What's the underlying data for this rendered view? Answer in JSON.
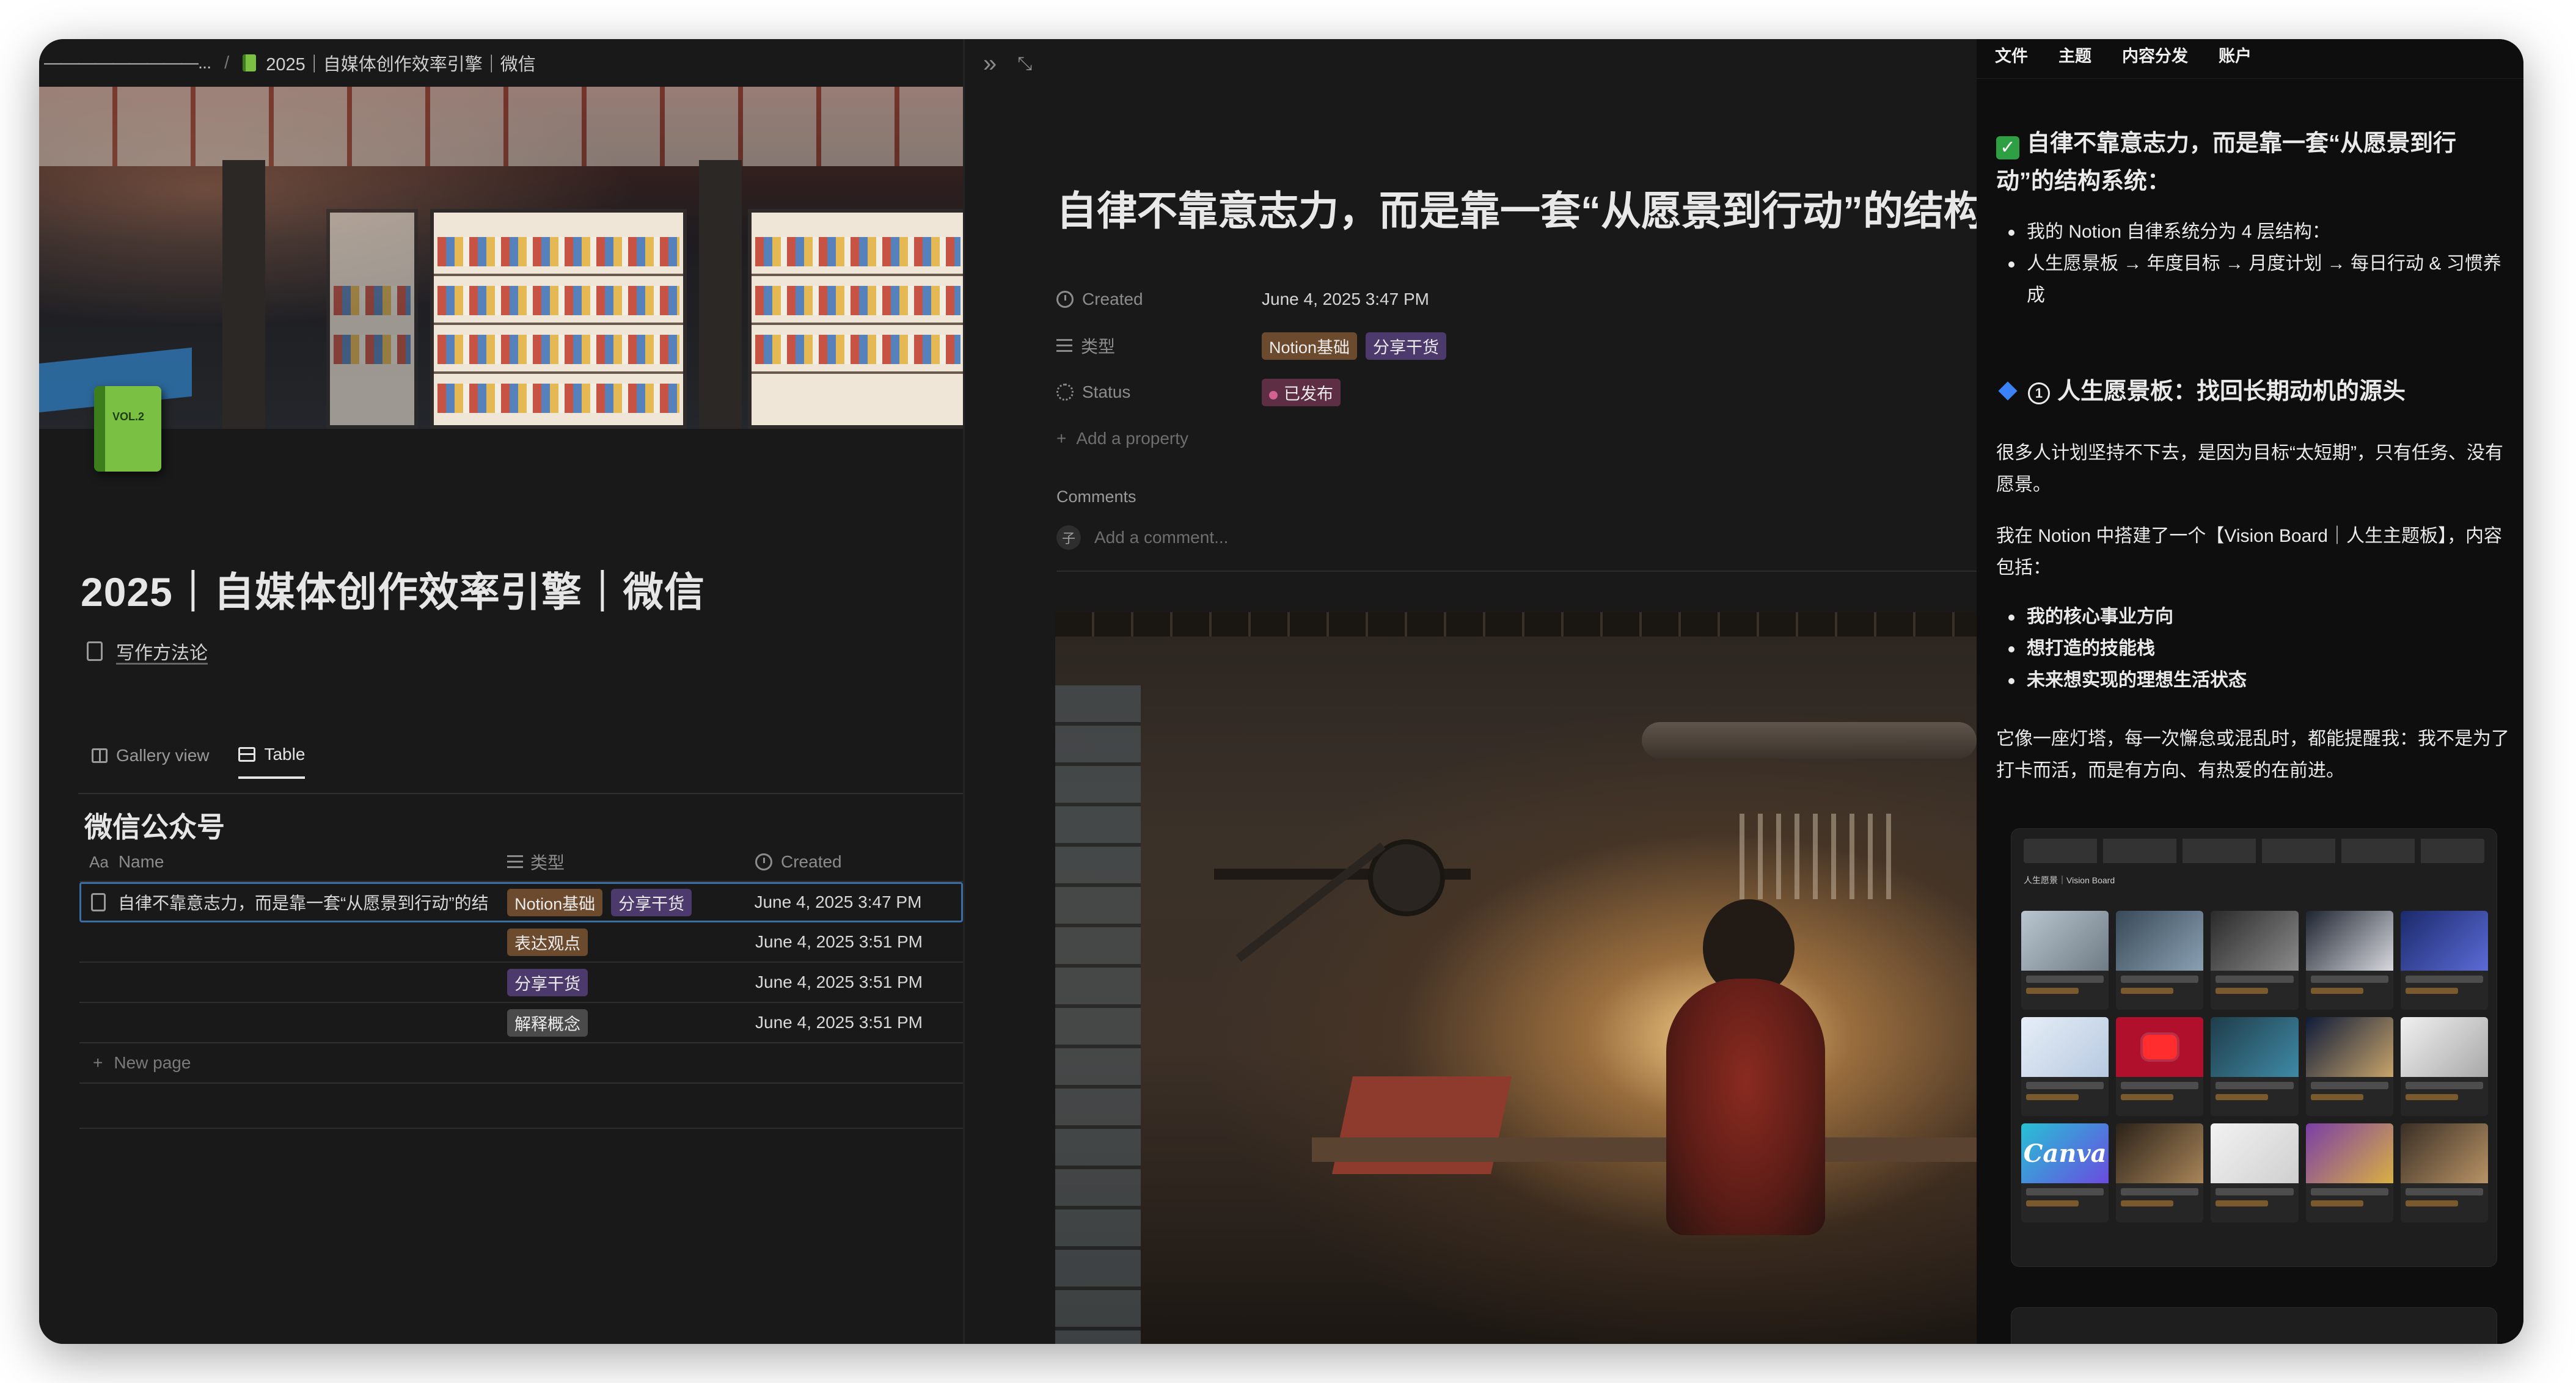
{
  "left": {
    "breadcrumb": {
      "parent": "—————————...",
      "current": "2025｜自媒体创作效率引擎｜微信"
    },
    "page_title": "2025｜自媒体创作效率引擎｜微信",
    "linked_page": "写作方法论",
    "views": [
      "Gallery view",
      "Table"
    ],
    "active_view": "Table",
    "database_title": "微信公众号",
    "columns": {
      "name": "Name",
      "type": "类型",
      "created": "Created",
      "name_prefix": "Aa"
    },
    "rows": [
      {
        "name": "自律不靠意志力，而是靠一套“从愿景到行动”的结",
        "tags": [
          "Notion基础",
          "分享干货"
        ],
        "created": "June 4, 2025 3:47 PM"
      },
      {
        "name": "",
        "tags": [
          "表达观点"
        ],
        "created": "June 4, 2025 3:51 PM"
      },
      {
        "name": "",
        "tags": [
          "分享干货"
        ],
        "created": "June 4, 2025 3:51 PM"
      },
      {
        "name": "",
        "tags": [
          "解释概念"
        ],
        "created": "June 4, 2025 3:51 PM"
      }
    ],
    "new_page": "New page"
  },
  "middle": {
    "title": "自律不靠意志力，而是靠一套“从愿景到行动”的结构系统",
    "props": {
      "created_label": "Created",
      "created_value": "June 4, 2025 3:47 PM",
      "type_label": "类型",
      "type_tags": [
        "Notion基础",
        "分享干货"
      ],
      "status_label": "Status",
      "status_value": "已发布",
      "add_property": "Add a property"
    },
    "comments_label": "Comments",
    "comment_placeholder": "Add a comment...",
    "avatar_initial": "子"
  },
  "right": {
    "menu": [
      "文件",
      "主题",
      "内容分发",
      "账户"
    ],
    "heading1": "自律不靠意志力，而是靠一套“从愿景到行动”的结构系统：",
    "bullets1": [
      "我的 Notion 自律系统分为 4 层结构：",
      "人生愿景板 → 年度目标 → 月度计划 → 每日行动 & 习惯养成"
    ],
    "heading2": "人生愿景板：找回长期动机的源头",
    "heading2_number": "1",
    "para1": "很多人计划坚持不下去，是因为目标“太短期”，只有任务、没有愿景。",
    "para2": "我在 Notion 中搭建了一个【Vision Board｜人生主题板】，内容包括：",
    "bullets2": [
      "我的核心事业方向",
      "想打造的技能栈",
      "未来想实现的理想生活状态"
    ],
    "para3": "它像一座灯塔，每一次懈怠或混乱时，都能提醒我：我不是为了打卡而活，而是有方向、有热爱的在前进。",
    "screenshot_title": "人生愿景｜Vision Board",
    "canva_label": "Canva"
  },
  "colors": {
    "window_bg": "#191919",
    "right_bg": "#0e0e0e",
    "tag_brown": "#6b4a2e",
    "tag_purple": "#4b3a6b",
    "tag_gray": "#4a4a4a",
    "status_pink": "#5e2f44",
    "selection_blue": "#3a6ea5"
  }
}
